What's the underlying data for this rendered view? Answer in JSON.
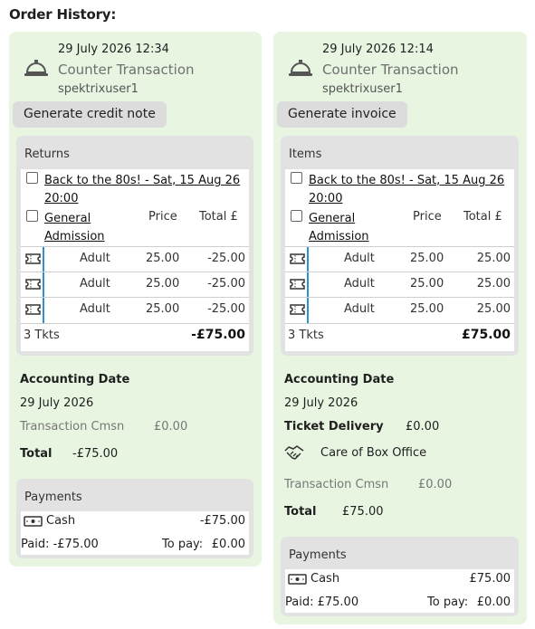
{
  "page": {
    "title": "Order History:"
  },
  "cards": [
    {
      "datetime": "29 July 2026 12:34",
      "type": "Counter Transaction",
      "user": "spektrixuser1",
      "icon": "service-bell-icon",
      "action_label": "Generate credit note",
      "panel": {
        "title": "Returns",
        "performance": "Back to the 80s! - Sat, 15 Aug 26 20:00",
        "ticket_type": "General Admission",
        "col_price": "Price",
        "col_total": "Total £",
        "rows": [
          {
            "band": "Adult",
            "price": "25.00",
            "total": "-25.00"
          },
          {
            "band": "Adult",
            "price": "25.00",
            "total": "-25.00"
          },
          {
            "band": "Adult",
            "price": "25.00",
            "total": "-25.00"
          }
        ],
        "count": "3 Tkts",
        "sum": "-£75.00"
      },
      "accounting_label": "Accounting Date",
      "accounting_date": "29 July 2026",
      "cmsn_label": "Transaction Cmsn",
      "cmsn_value": "£0.00",
      "total_label": "Total",
      "total_value": "-£75.00",
      "payments": {
        "title": "Payments",
        "method": "Cash",
        "amount": "-£75.00",
        "paid": "Paid: -£75.00",
        "to_pay_label": "To pay:",
        "to_pay_value": "£0.00"
      }
    },
    {
      "datetime": "29 July 2026 12:14",
      "type": "Counter Transaction",
      "user": "spektrixuser1",
      "icon": "service-bell-icon",
      "action_label": "Generate invoice",
      "panel": {
        "title": "Items",
        "performance": "Back to the 80s! - Sat, 15 Aug 26 20:00",
        "ticket_type": "General Admission",
        "col_price": "Price",
        "col_total": "Total £",
        "rows": [
          {
            "band": "Adult",
            "price": "25.00",
            "total": "25.00"
          },
          {
            "band": "Adult",
            "price": "25.00",
            "total": "25.00"
          },
          {
            "band": "Adult",
            "price": "25.00",
            "total": "25.00"
          }
        ],
        "count": "3 Tkts",
        "sum": "£75.00"
      },
      "accounting_label": "Accounting Date",
      "accounting_date": "29 July 2026",
      "delivery_label": "Ticket Delivery",
      "delivery_value": "£0.00",
      "delivery_method": "Care of Box Office",
      "delivery_icon": "handshake-icon",
      "cmsn_label": "Transaction Cmsn",
      "cmsn_value": "£0.00",
      "total_label": "Total",
      "total_value": "£75.00",
      "payments": {
        "title": "Payments",
        "method": "Cash",
        "amount": "£75.00",
        "paid": "Paid: £75.00",
        "to_pay_label": "To pay:",
        "to_pay_value": "£0.00"
      }
    }
  ],
  "colors": {
    "card_bg": "#e8f5e1",
    "panel_bg": "#e2e2e2",
    "accent_bar": "#2b93cf"
  }
}
